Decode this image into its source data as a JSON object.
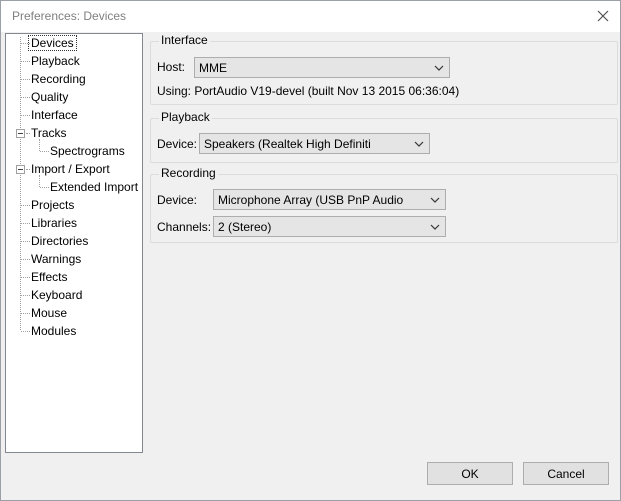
{
  "window": {
    "title": "Preferences: Devices"
  },
  "tree": {
    "items": [
      {
        "label": "Devices"
      },
      {
        "label": "Playback"
      },
      {
        "label": "Recording"
      },
      {
        "label": "Quality"
      },
      {
        "label": "Interface"
      },
      {
        "label": "Tracks"
      },
      {
        "label": "Spectrograms"
      },
      {
        "label": "Import / Export"
      },
      {
        "label": "Extended Import"
      },
      {
        "label": "Projects"
      },
      {
        "label": "Libraries"
      },
      {
        "label": "Directories"
      },
      {
        "label": "Warnings"
      },
      {
        "label": "Effects"
      },
      {
        "label": "Keyboard"
      },
      {
        "label": "Mouse"
      },
      {
        "label": "Modules"
      }
    ]
  },
  "interface_group": {
    "legend": "Interface",
    "host_label": "Host:",
    "host_value": "MME",
    "using_text": "Using: PortAudio V19-devel (built Nov 13 2015 06:36:04)"
  },
  "playback_group": {
    "legend": "Playback",
    "device_label": "Device:",
    "device_value": "Speakers (Realtek High Definiti"
  },
  "recording_group": {
    "legend": "Recording",
    "device_label": "Device:",
    "device_value": "Microphone Array (USB PnP Audio",
    "channels_label": "Channels:",
    "channels_value": "2 (Stereo)"
  },
  "buttons": {
    "ok": "OK",
    "cancel": "Cancel"
  }
}
